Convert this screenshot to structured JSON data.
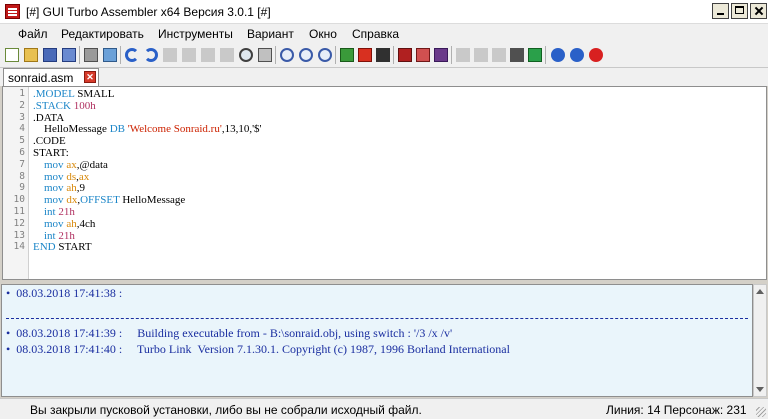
{
  "window": {
    "title": "[#] GUI Turbo Assembler x64 Версия 3.0.1 [#]"
  },
  "menu": [
    "Файл",
    "Редактировать",
    "Инструменты",
    "Вариант",
    "Окно",
    "Справка"
  ],
  "toolbar": {
    "icons": [
      "new-file-icon",
      "open-folder-icon",
      "save-icon",
      "save-all-icon",
      "print-icon",
      "export-icon",
      "undo-icon",
      "redo-icon",
      "cut-icon",
      "copy-icon",
      "paste-icon",
      "delete-icon",
      "find-icon",
      "replace-icon",
      "zoom-in-icon",
      "zoom-out-icon",
      "zoom-reset-icon",
      "assemble-icon",
      "link-icon",
      "run-icon",
      "debug-icon",
      "build-icon",
      "step-icon",
      "brackets-icon",
      "arrow-up-icon",
      "arrow-down-icon",
      "tools-icon",
      "download-icon",
      "help-icon",
      "info-icon",
      "power-icon"
    ]
  },
  "tab": {
    "label": "sonraid.asm",
    "close_glyph": "✕"
  },
  "editor": {
    "line_numbers": [
      "1",
      "2",
      "3",
      "4",
      "5",
      "6",
      "7",
      "8",
      "9",
      "10",
      "11",
      "12",
      "13",
      "14"
    ],
    "lines": [
      [
        {
          "t": ".MODEL",
          "c": "kw"
        },
        {
          "t": " SMALL",
          "c": ""
        }
      ],
      [
        {
          "t": ".STACK",
          "c": "kw"
        },
        {
          "t": " 100h",
          "c": "num"
        }
      ],
      [
        {
          "t": ".DATA",
          "c": ""
        }
      ],
      [
        {
          "t": "    HelloMessage ",
          "c": ""
        },
        {
          "t": "DB",
          "c": "kw"
        },
        {
          "t": " 'Welcome Sonraid.ru'",
          "c": "str"
        },
        {
          "t": ",13,10,'$'",
          "c": ""
        }
      ],
      [
        {
          "t": ".CODE",
          "c": ""
        }
      ],
      [
        {
          "t": "START:",
          "c": ""
        }
      ],
      [
        {
          "t": "    ",
          "c": ""
        },
        {
          "t": "mov",
          "c": "kw"
        },
        {
          "t": " ",
          "c": ""
        },
        {
          "t": "ax",
          "c": "reg"
        },
        {
          "t": ",@data",
          "c": ""
        }
      ],
      [
        {
          "t": "    ",
          "c": ""
        },
        {
          "t": "mov",
          "c": "kw"
        },
        {
          "t": " ",
          "c": ""
        },
        {
          "t": "ds",
          "c": "reg"
        },
        {
          "t": ",",
          "c": ""
        },
        {
          "t": "ax",
          "c": "reg"
        }
      ],
      [
        {
          "t": "    ",
          "c": ""
        },
        {
          "t": "mov",
          "c": "kw"
        },
        {
          "t": " ",
          "c": ""
        },
        {
          "t": "ah",
          "c": "reg"
        },
        {
          "t": ",9",
          "c": ""
        }
      ],
      [
        {
          "t": "    ",
          "c": ""
        },
        {
          "t": "mov",
          "c": "kw"
        },
        {
          "t": " ",
          "c": ""
        },
        {
          "t": "dx",
          "c": "reg"
        },
        {
          "t": ",",
          "c": ""
        },
        {
          "t": "OFFSET",
          "c": "kw"
        },
        {
          "t": " HelloMessage",
          "c": ""
        }
      ],
      [
        {
          "t": "    ",
          "c": ""
        },
        {
          "t": "int",
          "c": "kw"
        },
        {
          "t": " 21h",
          "c": "num"
        }
      ],
      [
        {
          "t": "    ",
          "c": ""
        },
        {
          "t": "mov",
          "c": "kw"
        },
        {
          "t": " ",
          "c": ""
        },
        {
          "t": "ah",
          "c": "reg"
        },
        {
          "t": ",4ch",
          "c": ""
        }
      ],
      [
        {
          "t": "    ",
          "c": ""
        },
        {
          "t": "int",
          "c": "kw"
        },
        {
          "t": " 21h",
          "c": "num"
        }
      ],
      [
        {
          "t": "END",
          "c": "kw"
        },
        {
          "t": " START",
          "c": ""
        }
      ]
    ]
  },
  "output": {
    "line1": "•  08.03.2018 17:41:38 :",
    "line2": "•  08.03.2018 17:41:39 :     Building executable from - B:\\sonraid.obj, using switch : '/3 /x /v'",
    "line3": "•  08.03.2018 17:41:40 :     Turbo Link  Version 7.1.30.1. Copyright (c) 1987, 1996 Borland International"
  },
  "status": {
    "message": "Вы закрыли пусковой установки, либо вы не собрали исходный файл.",
    "position": "Линия: 14 Персонаж: 231"
  },
  "colors": {
    "keyword": "#1c86c8",
    "register": "#d8890a",
    "string": "#cc2200",
    "number": "#b03060",
    "output_text": "#1a2ea0"
  }
}
